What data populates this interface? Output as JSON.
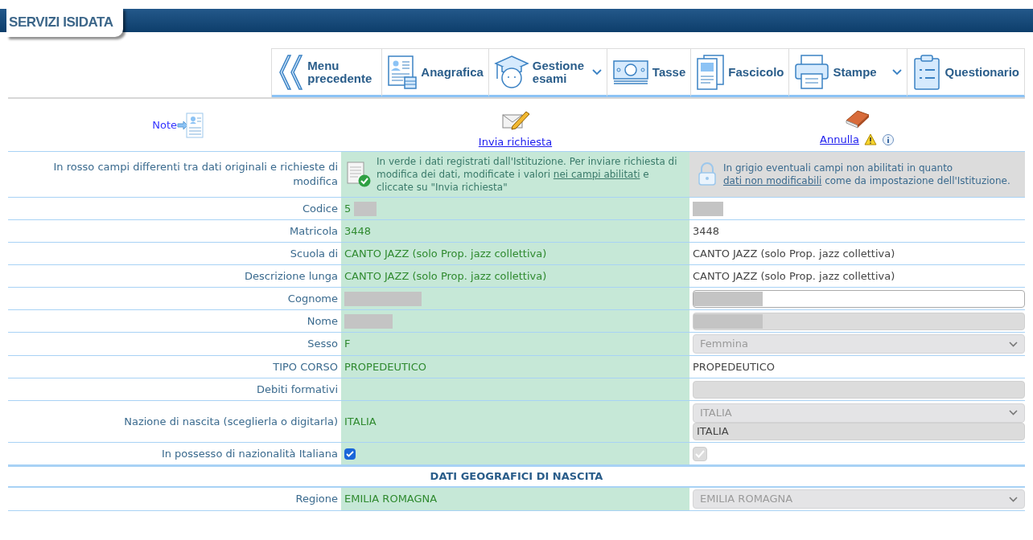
{
  "header": {
    "title": "SERVIZI ISIDATA"
  },
  "nav": [
    {
      "label": "Menu precedente",
      "dropdown": false
    },
    {
      "label": "Anagrafica",
      "dropdown": false
    },
    {
      "label": "Gestione esami",
      "dropdown": true
    },
    {
      "label": "Tasse",
      "dropdown": false
    },
    {
      "label": "Fascicolo",
      "dropdown": false
    },
    {
      "label": "Stampe",
      "dropdown": true
    },
    {
      "label": "Questionario",
      "dropdown": false
    }
  ],
  "actions": {
    "note": "Note",
    "send": "Invia richiesta",
    "cancel": "Annulla"
  },
  "legend": {
    "red": "In rosso campi differenti tra dati originali e richieste di modifica",
    "green_before": "In verde i dati registrati dall'Istituzione. Per inviare richiesta di modifica dei dati, modificate i valori ",
    "green_link": "nei campi abilitati",
    "green_after": " e cliccate su \"Invia richiesta\"",
    "grey_before": "In grigio eventuali campi non abilitati in quanto ",
    "grey_link": "dati non modificabili",
    "grey_after": " come da impostazione dell'Istituzione."
  },
  "rows": [
    {
      "kind": "field",
      "label": "Codice",
      "original": "5",
      "original_redacted": true,
      "edit": {
        "kind": "text",
        "redacted": true
      }
    },
    {
      "kind": "field",
      "label": "Matricola",
      "original": "3448",
      "edit": {
        "kind": "text",
        "value": "3448"
      }
    },
    {
      "kind": "field",
      "label": "Scuola di",
      "original": "CANTO JAZZ (solo Prop. jazz collettiva)",
      "edit": {
        "kind": "text",
        "value": "CANTO JAZZ (solo Prop. jazz collettiva)"
      }
    },
    {
      "kind": "field",
      "label": "Descrizione lunga",
      "original": "CANTO JAZZ (solo Prop. jazz collettiva)",
      "edit": {
        "kind": "text",
        "value": "CANTO JAZZ (solo Prop. jazz collettiva)"
      }
    },
    {
      "kind": "field",
      "label": "Cognome",
      "original_redacted": true,
      "edit": {
        "kind": "input",
        "redacted": true,
        "disabled": false
      }
    },
    {
      "kind": "field",
      "label": "Nome",
      "original_redacted": true,
      "edit": {
        "kind": "input",
        "redacted": true,
        "disabled": true
      }
    },
    {
      "kind": "field",
      "label": "Sesso",
      "original": "F",
      "edit": {
        "kind": "select",
        "value": "Femmina",
        "disabled": true
      }
    },
    {
      "kind": "field",
      "label": "TIPO CORSO",
      "original": "PROPEDEUTICO",
      "edit": {
        "kind": "text",
        "value": "PROPEDEUTICO"
      }
    },
    {
      "kind": "field",
      "label": "Debiti formativi",
      "edit": {
        "kind": "input",
        "disabled": true
      }
    },
    {
      "kind": "field",
      "label": "Nazione di nascita (sceglierla o digitarla)",
      "original": "ITALIA",
      "edit": {
        "kind": "select_input",
        "value": "ITALIA",
        "input_value": "ITALIA",
        "disabled": true
      }
    },
    {
      "kind": "check",
      "label": "In possesso di nazionalità Italiana",
      "original_checked": true,
      "edit": {
        "kind": "checkbox",
        "checked": true,
        "disabled": true
      }
    },
    {
      "kind": "section",
      "label": "DATI GEOGRAFICI DI NASCITA"
    },
    {
      "kind": "field",
      "label": "Regione",
      "original": "EMILIA ROMAGNA",
      "edit": {
        "kind": "select",
        "value": "EMILIA ROMAGNA",
        "disabled": true
      }
    }
  ]
}
